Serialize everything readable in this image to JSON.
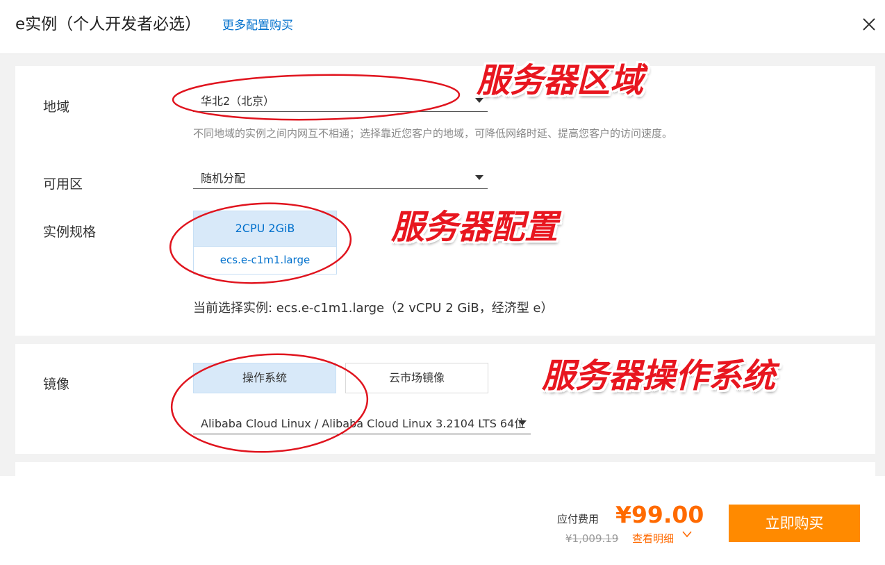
{
  "header": {
    "title": "e实例（个人开发者必选）",
    "more_link": "更多配置购买",
    "close_icon": "close-icon"
  },
  "region": {
    "label": "地域",
    "selected": "华北2（北京）",
    "hint": "不同地域的实例之间内网互不相通；选择靠近您客户的地域，可降低网络时延、提高您客户的访问速度。"
  },
  "zone": {
    "label": "可用区",
    "selected": "随机分配"
  },
  "instance": {
    "label": "实例规格",
    "spec": "2CPU 2GiB",
    "type": "ecs.e-c1m1.large",
    "current": "当前选择实例: ecs.e-c1m1.large（2 vCPU 2 GiB，经济型 e）"
  },
  "image": {
    "label": "镜像",
    "tabs": [
      {
        "label": "操作系统",
        "active": true
      },
      {
        "label": "云市场镜像",
        "active": false
      }
    ],
    "selected": "Alibaba Cloud Linux / Alibaba Cloud Linux 3.2104 LTS 64位"
  },
  "footer": {
    "fee_label": "应付费用",
    "price": "¥99.00",
    "original_price": "¥1,009.19",
    "detail_link": "查看明细",
    "buy_button": "立即购买"
  },
  "annotations": {
    "region": "服务器区域",
    "config": "服务器配置",
    "os": "服务器操作系统"
  },
  "colors": {
    "accent_blue": "#0070cc",
    "selected_bg": "#d8e9f9",
    "price_orange": "#ff6a00",
    "buy_button": "#ff8a00",
    "annotation_red": "#e8161f"
  }
}
